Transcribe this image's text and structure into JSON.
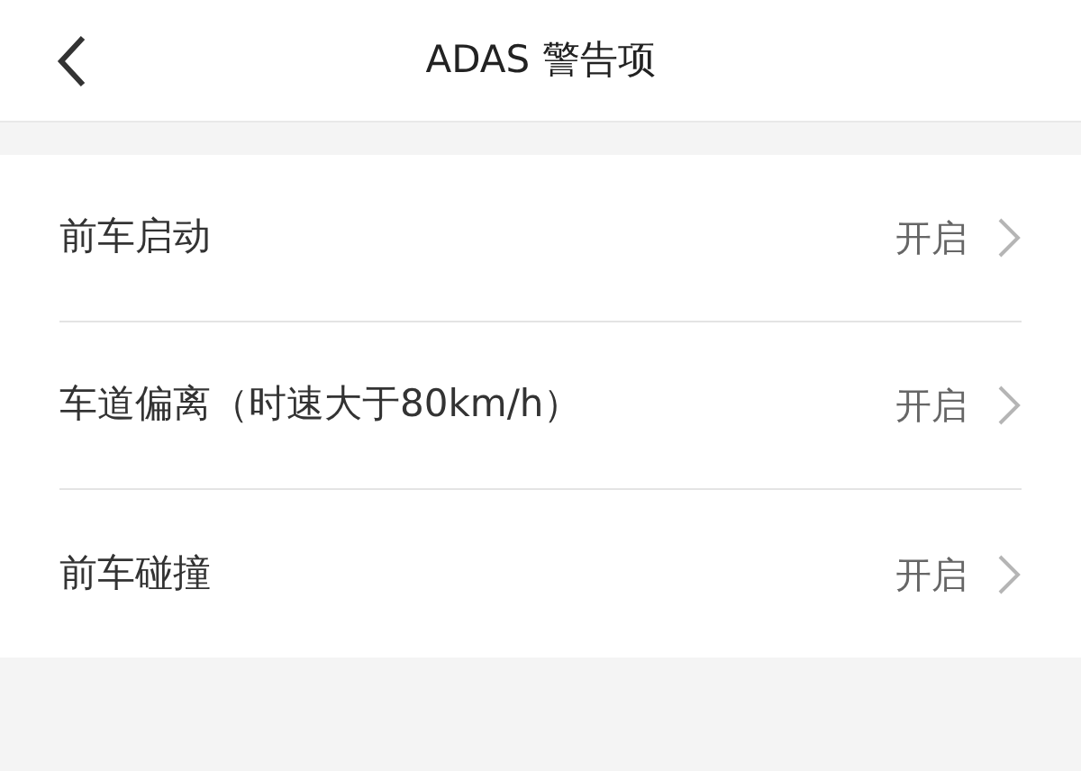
{
  "header": {
    "title": "ADAS 警告项"
  },
  "settings": [
    {
      "label": "前车启动",
      "value": "开启"
    },
    {
      "label": "车道偏离（时速大于80km/h）",
      "value": "开启"
    },
    {
      "label": "前车碰撞",
      "value": "开启"
    }
  ]
}
